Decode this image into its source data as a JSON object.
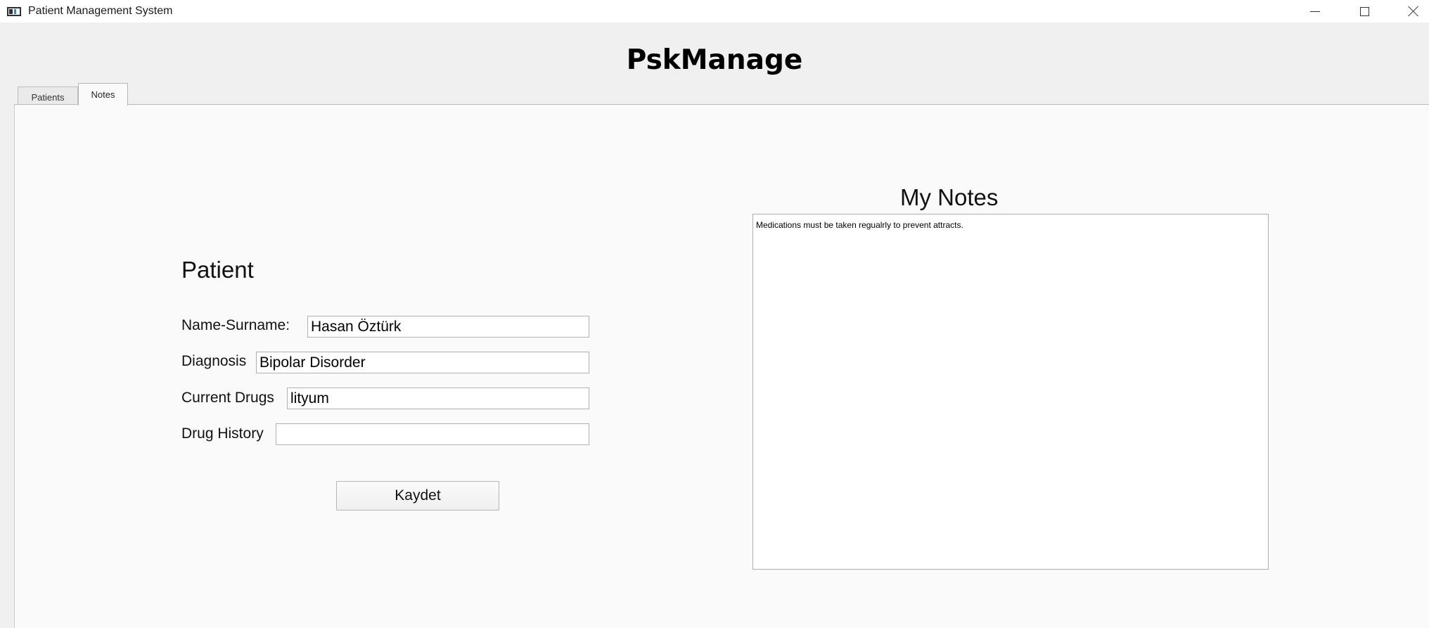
{
  "window": {
    "title": "Patient Management System",
    "minimize_glyph": "minimize-icon",
    "maximize_glyph": "maximize-icon",
    "close_glyph": "close-icon"
  },
  "header": {
    "app_name": "PskManage"
  },
  "tabs": [
    {
      "label": "Patients",
      "active": false
    },
    {
      "label": "Notes",
      "active": true
    }
  ],
  "patient_form": {
    "title": "Patient",
    "fields": [
      {
        "label": "Name-Surname:",
        "value": "Hasan Öztürk"
      },
      {
        "label": "Diagnosis",
        "value": "Bipolar Disorder"
      },
      {
        "label": "Current Drugs",
        "value": "lityum"
      },
      {
        "label": "Drug History",
        "value": ""
      }
    ],
    "save_label": "Kaydet"
  },
  "notes": {
    "title": "My Notes",
    "content": "Medications must be taken regualrly to prevent attracts."
  },
  "colors": {
    "window_bg": "#f0f0f0",
    "pane_bg": "#fafafa",
    "input_bg": "#ffffff",
    "border": "#b0b0b0"
  }
}
